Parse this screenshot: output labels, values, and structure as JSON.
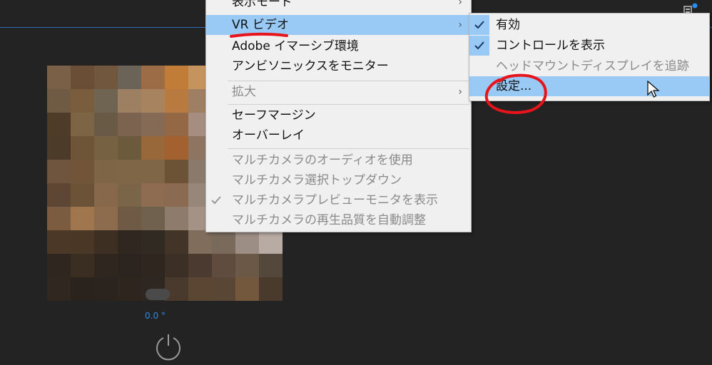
{
  "video": {
    "angle_text": "0.0 °",
    "mosaic_colors": [
      "#7a6047",
      "#6a4e35",
      "#70573d",
      "#6b6258",
      "#9b6c45",
      "#c17c38",
      "#c5945e",
      "#6a5d4c",
      "#4e3d2d",
      "#383027",
      "#6f5a44",
      "#7a5d3c",
      "#6e6451",
      "#9d7f62",
      "#a88360",
      "#b87a3e",
      "#9e7f63",
      "#786b5c",
      "#524231",
      "#3a3026",
      "#4e3b28",
      "#7c6444",
      "#695a45",
      "#7b6350",
      "#856a55",
      "#946844",
      "#a58e80",
      "#6e5a4a",
      "#513f2f",
      "#3c3024",
      "#4d3b29",
      "#6e5538",
      "#766143",
      "#6c5a3c",
      "#99683a",
      "#a3612f",
      "#8e7561",
      "#6a5849",
      "#4b3b2c",
      "#372c23",
      "#6f553d",
      "#725438",
      "#7e6546",
      "#7e6647",
      "#7f6646",
      "#6c5335",
      "#897a6c",
      "#6b5a4b",
      "#453628",
      "#332a22",
      "#5d4634",
      "#6c5237",
      "#87684b",
      "#7b6549",
      "#8e6c52",
      "#8a6b52",
      "#96877a",
      "#655545",
      "#3f3226",
      "#2f2820",
      "#7c5c40",
      "#a0764e",
      "#8d6c4e",
      "#6e5a45",
      "#70604e",
      "#8e7b6b",
      "#a39285",
      "#6a5a4c",
      "#3d3126",
      "#2e271f",
      "#4b3826",
      "#4a3725",
      "#3d2f22",
      "#302720",
      "#312a22",
      "#423426",
      "#816d5c",
      "#796a5c",
      "#9c8e84",
      "#b8aba3",
      "#302620",
      "#3a2d22",
      "#2f2620",
      "#2c241e",
      "#2f271f",
      "#3c2f25",
      "#4b3a2f",
      "#5f4c3e",
      "#6c5847",
      "#54473c",
      "#2f2720",
      "#2a221c",
      "#2b231d",
      "#2e261e",
      "#2e2620",
      "#4a3a2d",
      "#5b4533",
      "#5a4634",
      "#73583e",
      "#4a3a2c"
    ]
  },
  "context_menu": {
    "items": [
      {
        "label": "表示モード",
        "has_submenu": true,
        "enabled": true
      },
      {
        "label": "VR ビデオ",
        "has_submenu": true,
        "enabled": true,
        "highlighted": true
      },
      {
        "label": "Adobe イマーシブ環境",
        "enabled": true
      },
      {
        "label": "アンビソニックスをモニター",
        "enabled": true
      },
      {
        "label": "拡大",
        "has_submenu": true,
        "enabled": false
      },
      {
        "label": "セーフマージン",
        "enabled": true
      },
      {
        "label": "オーバーレイ",
        "enabled": true
      },
      {
        "label": "マルチカメラのオーディオを使用",
        "enabled": false
      },
      {
        "label": "マルチカメラ選択トップダウン",
        "enabled": false
      },
      {
        "label": "マルチカメラプレビューモニタを表示",
        "enabled": false,
        "checked": true
      },
      {
        "label": "マルチカメラの再生品質を自動調整",
        "enabled": false
      }
    ]
  },
  "vr_submenu": {
    "items": [
      {
        "label": "有効",
        "checked": true,
        "enabled": true
      },
      {
        "label": "コントロールを表示",
        "checked": true,
        "enabled": true
      },
      {
        "label": "ヘッドマウントディスプレイを追跡",
        "enabled": false
      },
      {
        "label": "設定...",
        "enabled": true,
        "highlighted": true
      }
    ]
  },
  "annotations": {
    "color": "#e8141c"
  },
  "colors": {
    "accent_blue": "#2d6fb8",
    "menu_highlight": "#99c9f5",
    "menu_bg": "#f0f0f0",
    "panel_bg": "#232323"
  }
}
